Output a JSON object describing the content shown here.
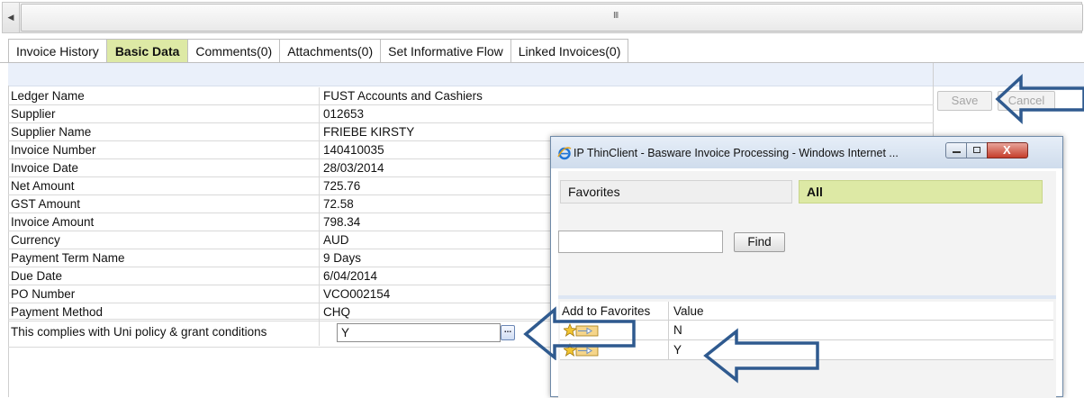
{
  "scrollbar": {
    "left_arrow": "◀",
    "grip": "III"
  },
  "tabs": [
    {
      "label": "Invoice History"
    },
    {
      "label": "Basic Data"
    },
    {
      "label": "Comments(0)"
    },
    {
      "label": "Attachments(0)"
    },
    {
      "label": "Set Informative Flow"
    },
    {
      "label": "Linked Invoices(0)"
    }
  ],
  "fields": [
    {
      "label": "Ledger Name",
      "value": "FUST Accounts and Cashiers"
    },
    {
      "label": "Supplier",
      "value": "012653"
    },
    {
      "label": "Supplier Name",
      "value": "FRIEBE KIRSTY"
    },
    {
      "label": "Invoice Number",
      "value": "140410035"
    },
    {
      "label": "Invoice Date",
      "value": "28/03/2014"
    },
    {
      "label": "Net Amount",
      "value": "725.76"
    },
    {
      "label": "GST Amount",
      "value": "72.58"
    },
    {
      "label": "Invoice Amount",
      "value": "798.34"
    },
    {
      "label": "Currency",
      "value": "AUD"
    },
    {
      "label": "Payment Term Name",
      "value": "9 Days"
    },
    {
      "label": "Due Date",
      "value": "6/04/2014"
    },
    {
      "label": "PO Number",
      "value": "VCO002154"
    },
    {
      "label": "Payment Method",
      "value": "CHQ"
    }
  ],
  "policy_row": {
    "label": "This complies with Uni policy & grant conditions",
    "value": "Y",
    "lookup_label": "..."
  },
  "actions": {
    "save": "Save",
    "cancel": "Cancel"
  },
  "popup": {
    "title": "IP ThinClient - Basware Invoice Processing - Windows Internet ...",
    "close_glyph": "X",
    "tab_favorites": "Favorites",
    "tab_all": "All",
    "search_value": "",
    "find_label": "Find",
    "columns": {
      "add": "Add to Favorites",
      "value": "Value"
    },
    "rows": [
      {
        "value": "N"
      },
      {
        "value": "Y"
      }
    ]
  }
}
